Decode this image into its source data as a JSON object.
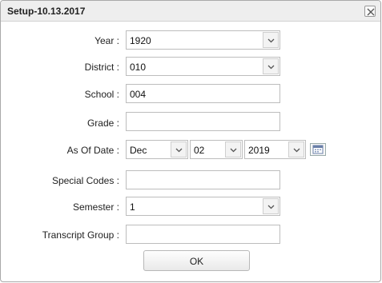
{
  "window": {
    "title": "Setup-10.13.2017"
  },
  "fields": {
    "year": {
      "label": "Year :",
      "value": "1920"
    },
    "district": {
      "label": "District :",
      "value": "010"
    },
    "school": {
      "label": "School :",
      "value": "004"
    },
    "grade": {
      "label": "Grade :",
      "value": ""
    },
    "as_of_date": {
      "label": "As Of Date :",
      "month": "Dec",
      "day": "02",
      "year": "2019"
    },
    "special_codes": {
      "label": "Special Codes :",
      "value": ""
    },
    "semester": {
      "label": "Semester :",
      "value": "1"
    },
    "transcript_group": {
      "label": "Transcript Group :",
      "value": ""
    }
  },
  "buttons": {
    "ok": "OK"
  },
  "icons": {
    "close": "close-icon",
    "dropdown": "chevron-down-icon",
    "calendar": "calendar-icon"
  }
}
